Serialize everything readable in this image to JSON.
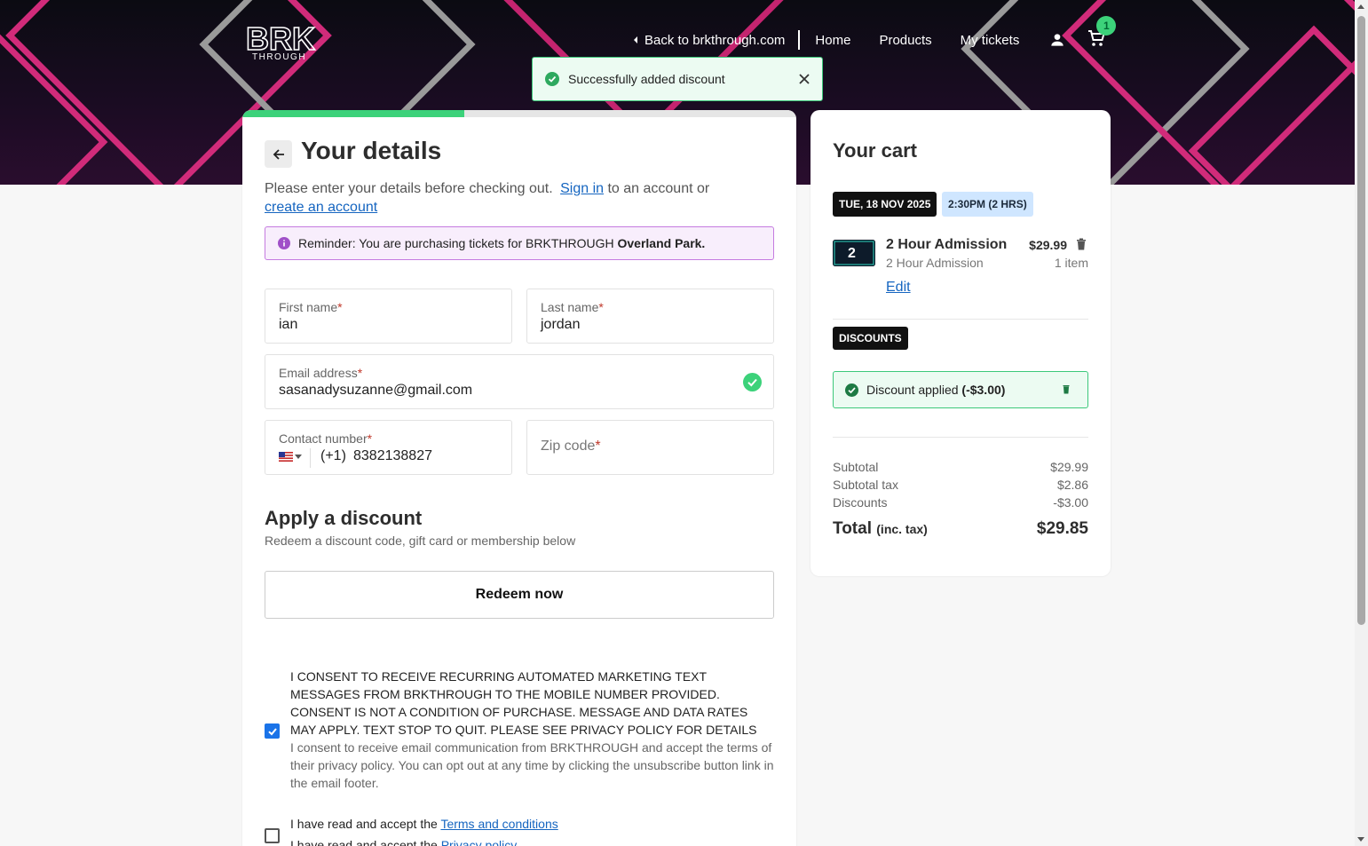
{
  "brand": {
    "logo_text": "BRK",
    "logo_sub": "THROUGH",
    "accent": "#3cd27a"
  },
  "nav": {
    "back_label": "Back to brkthrough.com",
    "home": "Home",
    "products": "Products",
    "my_tickets": "My tickets",
    "cart_count": "1"
  },
  "toast": {
    "message": "Successfully added discount"
  },
  "progress": {
    "fraction": 0.4
  },
  "details": {
    "title": "Your details",
    "intro_before": "Please enter your details before checking out.",
    "sign_in": "Sign in",
    "intro_mid": "to an account or",
    "create_account": "create an account",
    "reminder_text": "Reminder: You are purchasing tickets for BRKTHROUGH",
    "reminder_location": "Overland Park."
  },
  "form": {
    "first_name": {
      "label": "First name",
      "value": "ian"
    },
    "last_name": {
      "label": "Last name",
      "value": "jordan"
    },
    "email": {
      "label": "Email address",
      "value": "sasanadysuzanne@gmail.com"
    },
    "contact": {
      "label": "Contact number",
      "dial_code": "(+1)",
      "value": "8382138827"
    },
    "zip": {
      "placeholder": "Zip code"
    },
    "required_mark": "*"
  },
  "discount": {
    "title": "Apply a discount",
    "subtitle": "Redeem a discount code, gift card or membership below",
    "redeem_button": "Redeem now"
  },
  "consent": {
    "sms_text": "I CONSENT TO RECEIVE RECURRING AUTOMATED MARKETING TEXT MESSAGES FROM BRKTHROUGH TO THE MOBILE NUMBER PROVIDED. CONSENT IS NOT A CONDITION OF PURCHASE. MESSAGE AND DATA RATES MAY APPLY. TEXT STOP TO QUIT. PLEASE SEE PRIVACY POLICY FOR DETAILS",
    "email_text": "I consent to receive email communication from BRKTHROUGH and accept the terms of their privacy policy. You can opt out at any time by clicking the unsubscribe button link in the email footer.",
    "sms_checked": true,
    "terms_prefix": "I have read and accept the",
    "terms_link": "Terms and conditions",
    "privacy_prefix": "I have read and accept the",
    "privacy_link": "Privacy policy",
    "terms_checked": false
  },
  "cart": {
    "title": "Your cart",
    "date": "TUE, 18 NOV 2025",
    "time": "2:30PM (2 HRS)",
    "item": {
      "name": "2 Hour Admission",
      "subtitle": "2 Hour Admission",
      "price": "$29.99",
      "qty": "1 item",
      "edit": "Edit",
      "thumb_text": "2"
    },
    "discounts_label": "DISCOUNTS",
    "discount_applied": "Discount applied",
    "discount_amount": "(-$3.00)",
    "subtotal_label": "Subtotal",
    "subtotal": "$29.99",
    "tax_label": "Subtotal tax",
    "tax": "$2.86",
    "discounts_row_label": "Discounts",
    "discounts_value": "-$3.00",
    "total_label": "Total",
    "total_suffix": "(inc. tax)",
    "total": "$29.85"
  }
}
